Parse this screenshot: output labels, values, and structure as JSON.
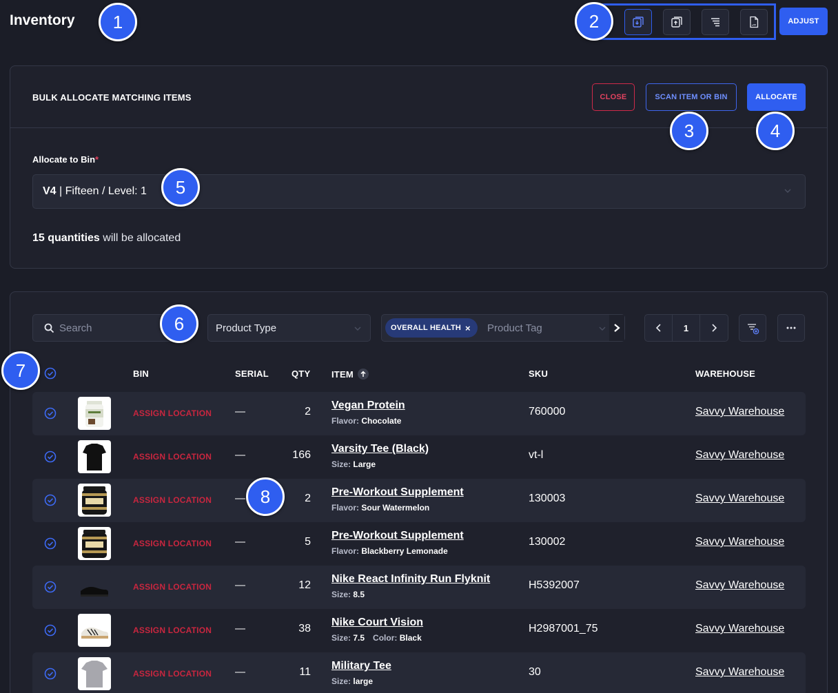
{
  "page": {
    "title": "Inventory"
  },
  "markers": [
    "1",
    "2",
    "3",
    "4",
    "5",
    "6",
    "7",
    "8"
  ],
  "toolbar": {
    "icons": [
      "import-icon",
      "export-icon",
      "list-icon",
      "csv-file-icon"
    ],
    "adjust_label": "ADJUST"
  },
  "bulk": {
    "title": "BULK ALLOCATE MATCHING ITEMS",
    "close_label": "CLOSE",
    "scan_label": "SCAN ITEM OR BIN",
    "allocate_label": "ALLOCATE",
    "bin_label": "Allocate to Bin",
    "required_mark": "*",
    "bin_code": "V4",
    "bin_rest": " | Fifteen / Level: 1",
    "qty_bold": "15 quantities",
    "qty_rest": " will be allocated"
  },
  "filters": {
    "search_placeholder": "Search",
    "product_type": "Product Type",
    "tag_chip": "OVERALL HEALTH",
    "tag_chip_remove": "×",
    "tag_placeholder": "Product Tag",
    "page": "1"
  },
  "table": {
    "headers": {
      "bin": "BIN",
      "serial": "SERIAL",
      "qty": "QTY",
      "item": "ITEM",
      "sku": "SKU",
      "warehouse": "WAREHOUSE"
    },
    "rows": [
      {
        "bin": "ASSIGN LOCATION",
        "serial": "—",
        "qty": "2",
        "name": "Vegan Protein",
        "attrs": [
          {
            "k": "Flavor:",
            "v": "Chocolate"
          }
        ],
        "sku": "760000",
        "warehouse": "Savvy Warehouse",
        "thumb": "protein-tub"
      },
      {
        "bin": "ASSIGN LOCATION",
        "serial": "—",
        "qty": "166",
        "name": "Varsity Tee (Black)",
        "attrs": [
          {
            "k": "Size:",
            "v": "Large"
          }
        ],
        "sku": "vt-l",
        "warehouse": "Savvy Warehouse",
        "thumb": "black-tee"
      },
      {
        "bin": "ASSIGN LOCATION",
        "serial": "—",
        "qty": "2",
        "name": "Pre-Workout Supplement",
        "attrs": [
          {
            "k": "Flavor:",
            "v": "Sour Watermelon"
          }
        ],
        "sku": "130003",
        "warehouse": "Savvy Warehouse",
        "thumb": "total-war"
      },
      {
        "bin": "ASSIGN LOCATION",
        "serial": "—",
        "qty": "5",
        "name": "Pre-Workout Supplement",
        "attrs": [
          {
            "k": "Flavor:",
            "v": "Blackberry Lemonade"
          }
        ],
        "sku": "130002",
        "warehouse": "Savvy Warehouse",
        "thumb": "total-war"
      },
      {
        "bin": "ASSIGN LOCATION",
        "serial": "—",
        "qty": "12",
        "name": "Nike React Infinity Run Flyknit",
        "attrs": [
          {
            "k": "Size:",
            "v": "8.5"
          }
        ],
        "sku": "H5392007",
        "warehouse": "Savvy Warehouse",
        "thumb": "black-shoe"
      },
      {
        "bin": "ASSIGN LOCATION",
        "serial": "—",
        "qty": "38",
        "name": "Nike Court Vision",
        "attrs": [
          {
            "k": "Size:",
            "v": "7.5"
          },
          {
            "k": "Color:",
            "v": "Black"
          }
        ],
        "sku": "H2987001_75",
        "warehouse": "Savvy Warehouse",
        "thumb": "white-shoe"
      },
      {
        "bin": "ASSIGN LOCATION",
        "serial": "—",
        "qty": "11",
        "name": "Military Tee",
        "attrs": [
          {
            "k": "Size:",
            "v": "large"
          }
        ],
        "sku": "30",
        "warehouse": "Savvy Warehouse",
        "thumb": "grey-tee"
      }
    ]
  },
  "colors": {
    "accent": "#2f5ef0",
    "danger": "#c8263f",
    "background": "#1b1d27"
  }
}
